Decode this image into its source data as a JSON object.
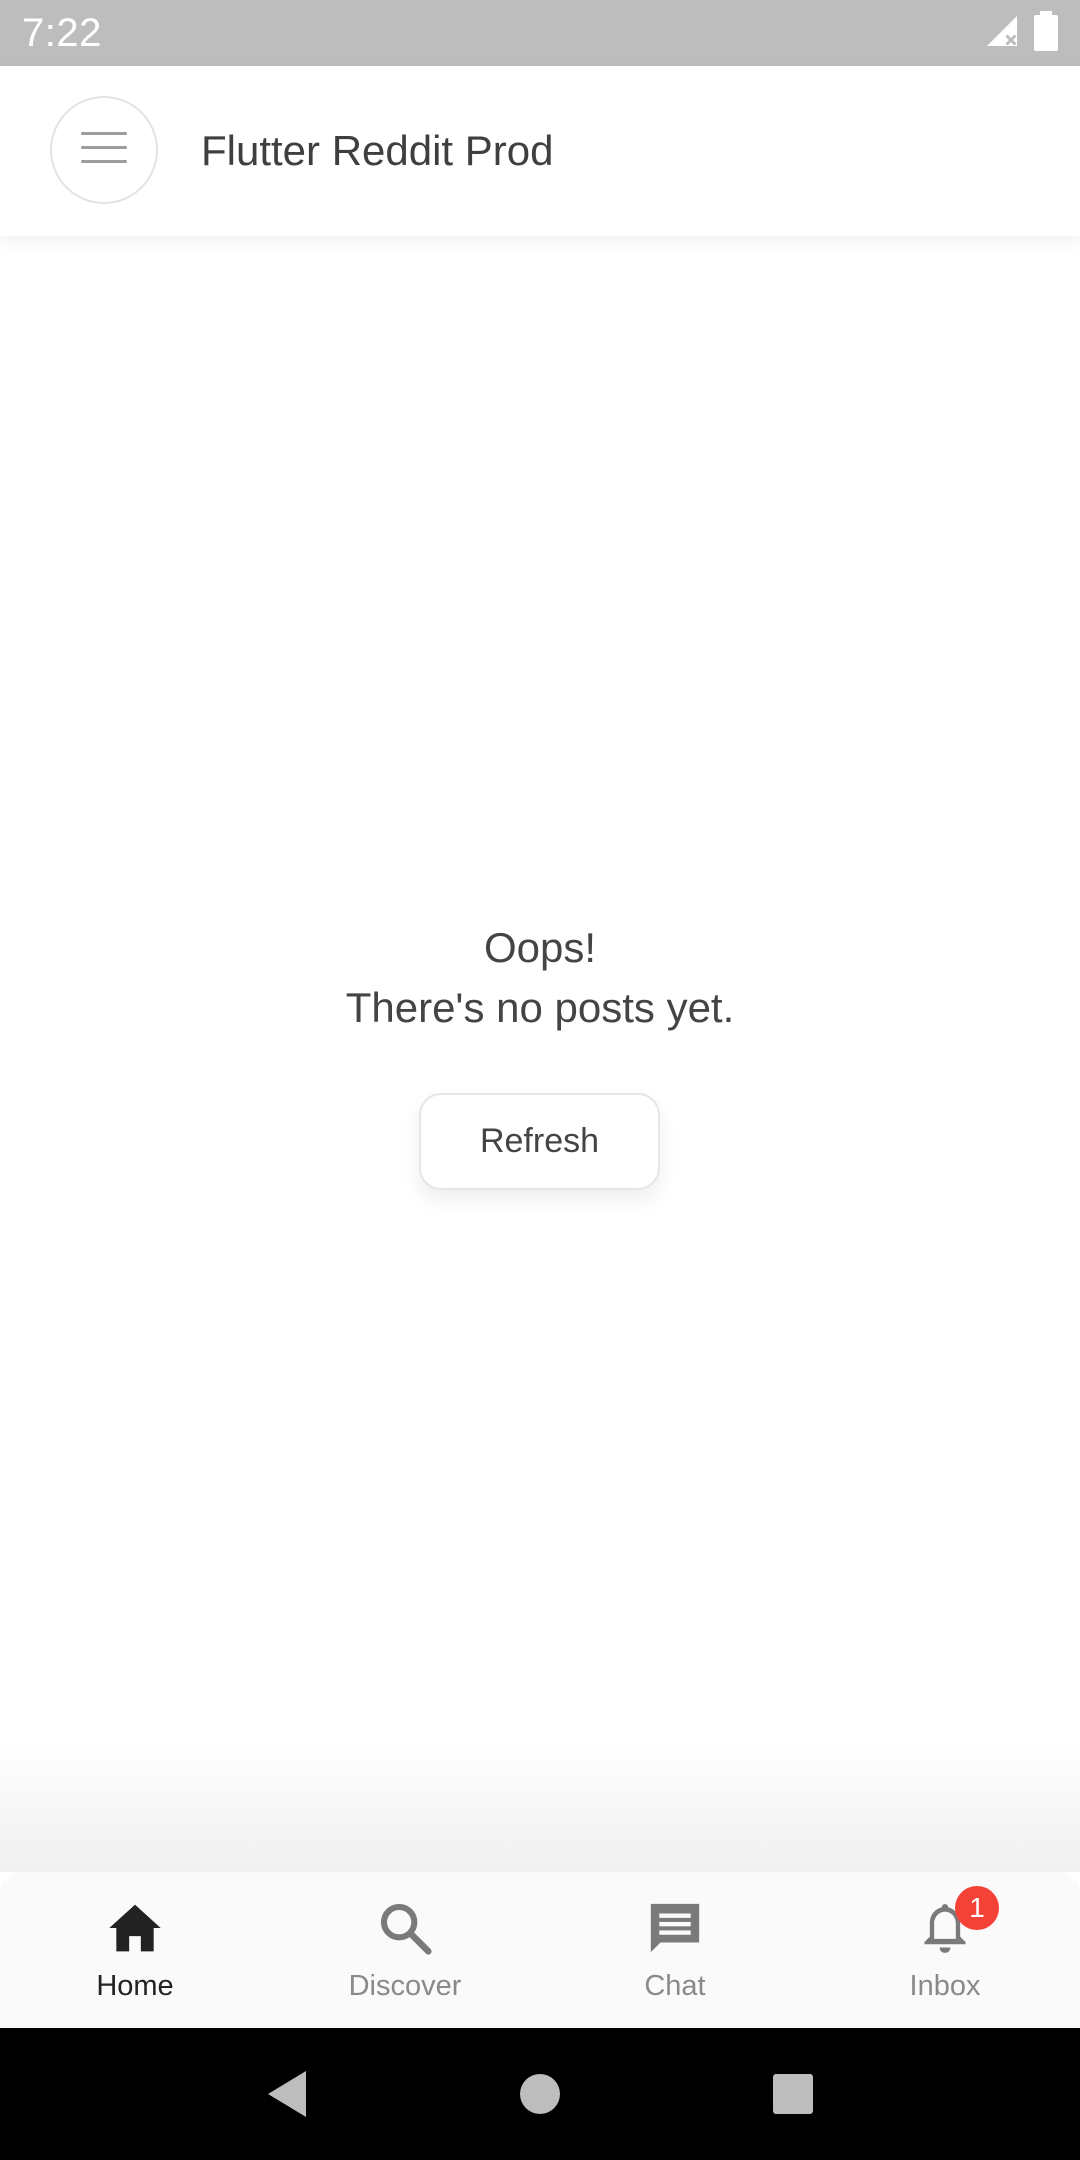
{
  "status_bar": {
    "time": "7:22",
    "icons": [
      "signal-off-icon",
      "battery-icon"
    ]
  },
  "app_bar": {
    "title": "Flutter Reddit Prod",
    "menu_icon": "hamburger-menu-icon"
  },
  "empty_state": {
    "title": "Oops!",
    "message": "There's no posts yet.",
    "refresh_label": "Refresh"
  },
  "bottom_nav": {
    "items": [
      {
        "label": "Home",
        "icon": "home-icon",
        "active": true
      },
      {
        "label": "Discover",
        "icon": "search-icon",
        "active": false
      },
      {
        "label": "Chat",
        "icon": "chat-icon",
        "active": false
      },
      {
        "label": "Inbox",
        "icon": "bell-icon",
        "active": false,
        "badge": "1"
      }
    ]
  },
  "colors": {
    "status_bar": "#bdbdbd",
    "active_nav": "#222222",
    "inactive_nav": "#8a8a8a",
    "badge": "#f44336"
  }
}
